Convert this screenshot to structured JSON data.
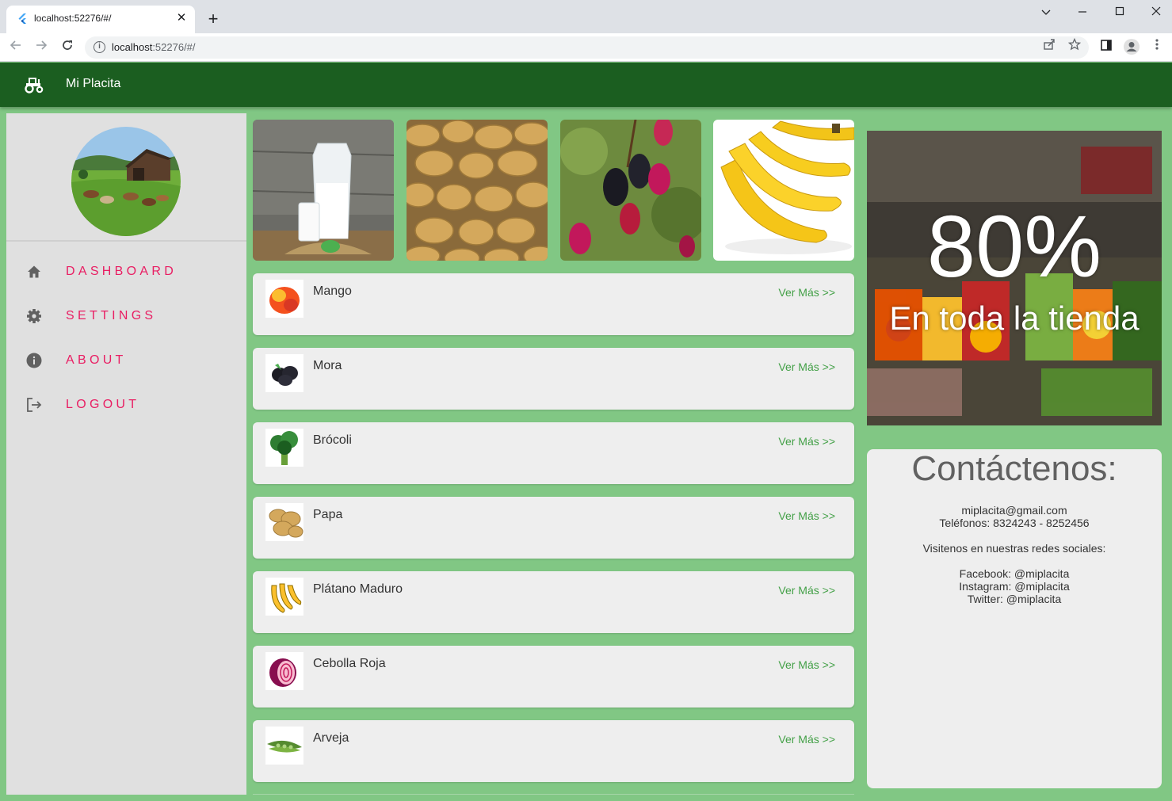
{
  "browser": {
    "tab_title": "localhost:52276/#/",
    "url_host": "localhost",
    "url_rest": ":52276/#/",
    "new_tab_label": "+",
    "close_tab_label": "✕"
  },
  "app": {
    "title": "Mi Placita",
    "logo_icon": "tractor-icon",
    "colors": {
      "primary": "#1b5e20",
      "background": "#81c784",
      "accent": "#e91e63",
      "link": "#43a047"
    }
  },
  "sidebar": {
    "avatar_icon": "farm-landscape-image",
    "items": [
      {
        "label": "DASHBOARD",
        "icon": "home-icon"
      },
      {
        "label": "SETTINGS",
        "icon": "gear-icon"
      },
      {
        "label": "ABOUT",
        "icon": "info-icon"
      },
      {
        "label": "LOGOUT",
        "icon": "logout-icon"
      }
    ]
  },
  "featured": [
    "milk-image",
    "potatoes-image",
    "blackberries-image",
    "bananas-image"
  ],
  "products": [
    {
      "name": "Mango",
      "link": "Ver Más >>",
      "icon": "mango-image"
    },
    {
      "name": "Mora",
      "link": "Ver Más >>",
      "icon": "blackberry-image"
    },
    {
      "name": "Brócoli",
      "link": "Ver Más >>",
      "icon": "broccoli-image"
    },
    {
      "name": "Papa",
      "link": "Ver Más >>",
      "icon": "potato-image"
    },
    {
      "name": "Plátano Maduro",
      "link": "Ver Más >>",
      "icon": "banana-image"
    },
    {
      "name": "Cebolla Roja",
      "link": "Ver Más >>",
      "icon": "red-onion-image"
    },
    {
      "name": "Arveja",
      "link": "Ver Más >>",
      "icon": "peas-image"
    }
  ],
  "promo": {
    "big": "80%",
    "sub": "En toda la tienda"
  },
  "contact": {
    "title": "Contáctenos:",
    "email": "miplacita@gmail.com",
    "phones": "Teléfonos: 8324243 - 8252456",
    "social_intro": "Visitenos en nuestras redes sociales:",
    "facebook": "Facebook: @miplacita",
    "instagram": "Instagram: @miplacita",
    "twitter": "Twitter: @miplacita"
  }
}
